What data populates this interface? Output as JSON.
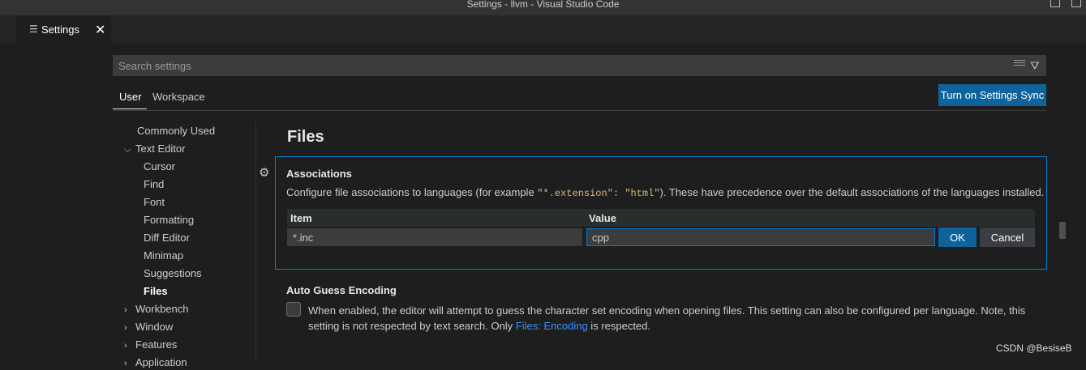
{
  "window": {
    "title": "Settings - llvm - Visual Studio Code"
  },
  "tab": {
    "icon": "settings-lines-icon",
    "label": "Settings",
    "close_glyph": "✕"
  },
  "search": {
    "placeholder": "Search settings"
  },
  "scope_tabs": {
    "user": "User",
    "workspace": "Workspace"
  },
  "sync_button": "Turn on Settings Sync",
  "toc": {
    "commonly_used": "Commonly Used",
    "text_editor": "Text Editor",
    "cursor": "Cursor",
    "find": "Find",
    "font": "Font",
    "formatting": "Formatting",
    "diff_editor": "Diff Editor",
    "minimap": "Minimap",
    "suggestions": "Suggestions",
    "files": "Files",
    "workbench": "Workbench",
    "window": "Window",
    "features": "Features",
    "application": "Application"
  },
  "section_title": "Files",
  "associations": {
    "title": "Associations",
    "desc_before": "Configure file associations to languages (for example ",
    "desc_code": "\"*.extension\": \"html\"",
    "desc_after": "). These have precedence over the default associations of the languages installed.",
    "col_item": "Item",
    "col_value": "Value",
    "item_value": "*.inc",
    "value_value": "cpp",
    "ok_label": "OK",
    "cancel_label": "Cancel"
  },
  "auto_guess": {
    "title": "Auto Guess Encoding",
    "desc_before": "When enabled, the editor will attempt to guess the character set encoding when opening files. This setting can also be configured per language. Note, this setting is not respected by text search. Only ",
    "link": "Files: Encoding",
    "desc_after": " is respected.",
    "checked": false
  },
  "watermark": "CSDN @BesiseB"
}
